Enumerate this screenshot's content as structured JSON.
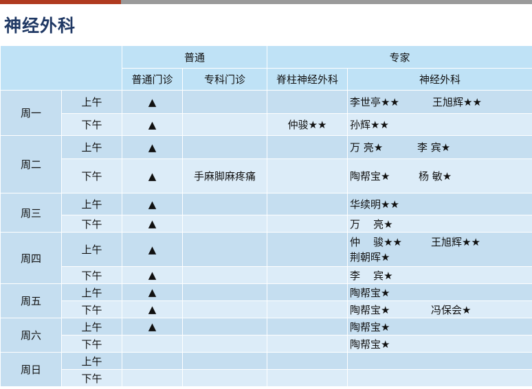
{
  "title": "神经外科",
  "header": {
    "group_general": "普通",
    "group_expert": "专家",
    "col_general_clinic": "普通门诊",
    "col_special_clinic": "专科门诊",
    "col_spine": "脊柱神经外科",
    "col_neuro": "神经外科"
  },
  "symbols": {
    "triangle": "▲"
  },
  "days": [
    {
      "name": "周一",
      "am": "上午",
      "pm": "下午"
    },
    {
      "name": "周二",
      "am": "上午",
      "pm": "下午"
    },
    {
      "name": "周三",
      "am": "上午",
      "pm": "下午"
    },
    {
      "name": "周四",
      "am": "上午",
      "pm": "下午"
    },
    {
      "name": "周五",
      "am": "上午",
      "pm": "下午"
    },
    {
      "name": "周六",
      "am": "上午",
      "pm": "下午"
    },
    {
      "name": "周日",
      "am": "上午",
      "pm": "下午"
    }
  ],
  "special": {
    "tue_pm": "手麻脚麻疼痛"
  },
  "spine": {
    "mon_pm": "仲骏★★"
  },
  "neuro": {
    "mon_am_1": "李世亭★★",
    "mon_am_2": "王旭辉★★",
    "mon_pm_1": "孙辉★★",
    "tue_am_1": "万 亮★",
    "tue_am_2": "李 宾★",
    "tue_pm_1": "陶帮宝★",
    "tue_pm_2": "杨  敏★",
    "wed_am_1": "华续明★★",
    "wed_pm_1": "万    亮★",
    "thu_am_1": "仲    骏★★",
    "thu_am_2": "王旭辉★★",
    "thu_am_3": "荆朝晖★",
    "thu_pm_1": "李    宾★",
    "fri_am_1": "陶帮宝★",
    "fri_pm_1": "陶帮宝★",
    "fri_pm_2": "冯保会★",
    "sat_am_1": "陶帮宝★",
    "sat_pm_1": "陶帮宝★"
  }
}
